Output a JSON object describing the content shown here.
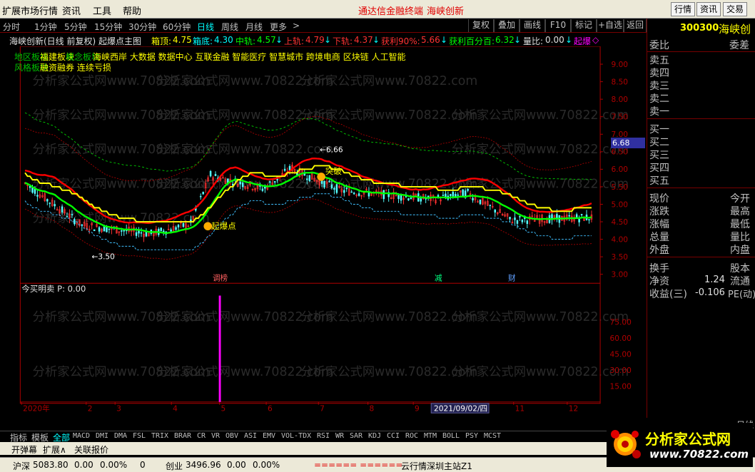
{
  "menu": {
    "items": [
      "扩展市场行情",
      "资讯",
      "工具",
      "帮助"
    ],
    "center_links": [
      "通达信金融终端",
      "海峡创新"
    ],
    "right_buttons": [
      "行情",
      "资讯",
      "交易"
    ]
  },
  "period_bar": {
    "periods": [
      "分时",
      "1分钟",
      "5分钟",
      "15分钟",
      "30分钟",
      "60分钟",
      "日线",
      "周线",
      "月线",
      "更多",
      ">"
    ],
    "active": "日线",
    "tool_buttons": [
      "复权",
      "叠加",
      "画线",
      "F10",
      "标记",
      "+自选",
      "返回"
    ]
  },
  "info_bar": {
    "title": "海峡创新(日线 前复权) 起爆点主图",
    "box_top_label": "箱顶:",
    "box_top": "4.75",
    "box_bottom_label": "箱底:",
    "box_bottom": "4.30",
    "mid_label": "中轨:",
    "mid": "4.57",
    "upper_label": "上轨:",
    "upper": "4.79",
    "lower_label": "下轨:",
    "lower": "4.37",
    "profit90_label": "获利90%:",
    "profit90": "5.66",
    "profitpct_label": "获利百分百:",
    "profitpct": "6.32",
    "volratio_label": "量比:",
    "volratio": "0.00",
    "explode_label": "起爆"
  },
  "concepts": {
    "prefix1": "地区板块",
    "prefix2": "福建板块",
    "prefix3": "概念板块",
    "line1": "海峡西岸 大数据 数据中心 互联金融 智能医疗 智慧城市 跨境电商 区块链 人工智能",
    "prefix4": "风格板块",
    "line2": "融资融券 连续亏损"
  },
  "chart_data": {
    "type": "candlestick",
    "price_axis_ticks": [
      "9.00",
      "8.50",
      "8.00",
      "7.50",
      "7.00",
      "6.50",
      "6.00",
      "5.50",
      "5.00",
      "4.50",
      "4.00",
      "3.50",
      "3.00"
    ],
    "price_marker": "6.68",
    "high_label": "6.66",
    "low_label": "3.50",
    "signal_labels": [
      "起爆点",
      "突破"
    ],
    "event_labels": [
      "调榜",
      "减",
      "财"
    ],
    "month_labels": [
      "2020年",
      "2",
      "3",
      "4",
      "5",
      "6",
      "7",
      "8",
      "9",
      "10",
      "11",
      "12"
    ],
    "date_cursor": "2021/09/02/四",
    "subchart_title": "今买明卖 P: 0.00",
    "subchart_ticks": [
      "75.00",
      "60.00",
      "45.00",
      "30.00",
      "15.00"
    ],
    "subchart_values": [
      100
    ],
    "watermark": "分析家公式网www.70822.com"
  },
  "right_panel": {
    "code": "300300",
    "name": "海峡创",
    "weibi_label": "委比",
    "weicha_label": "委差",
    "sells": [
      "卖五",
      "卖四",
      "卖三",
      "卖二",
      "卖一"
    ],
    "buys": [
      "买一",
      "买二",
      "买三",
      "买四",
      "买五"
    ],
    "quote_labels": [
      "现价",
      "涨跌",
      "涨幅",
      "总量",
      "外盘"
    ],
    "quote_labels2": [
      "今开",
      "最高",
      "最低",
      "量比",
      "内盘"
    ],
    "turnover_label": "换手",
    "shares_label": "股本",
    "nav_label": "净资",
    "nav_value": "1.24",
    "float_label": "流通",
    "eps_label": "收益(三)",
    "eps_value": "-0.106",
    "pe_label": "PE(动)",
    "period_label": "日线"
  },
  "indicator_tabs": {
    "left": [
      "指标",
      "模板"
    ],
    "items": [
      "全部",
      "MACD",
      "DMI",
      "DMA",
      "FSL",
      "TRIX",
      "BRAR",
      "CR",
      "VR",
      "OBV",
      "ASI",
      "EMV",
      "VOL-TDX",
      "RSI",
      "WR",
      "SAR",
      "KDJ",
      "CCI",
      "ROC",
      "MTM",
      "BOLL",
      "PSY",
      "MCST"
    ]
  },
  "bottom_tabs": [
    "开弹幕",
    "扩展∧",
    "关联报价"
  ],
  "status_bar": {
    "sh_label": "沪深",
    "sh_value": "5083.80",
    "sh_change": "0.00",
    "sh_pct": "0.00%",
    "sh_vol": "0",
    "cy_label": "创业",
    "cy_value": "3496.96",
    "cy_change": "0.00",
    "cy_pct": "0.00%",
    "server": "云行情深圳主站Z1"
  },
  "logo": {
    "text": "分析家公式网",
    "url": "www.70822.com"
  },
  "colors": {
    "up": "#ff3232",
    "down": "#54ffff",
    "upper_band": "#ff0000",
    "mid_band": "#00ff00",
    "yellow_line": "#ffff00",
    "accent": "#ff00ff",
    "grid_frame": "#b00000"
  }
}
